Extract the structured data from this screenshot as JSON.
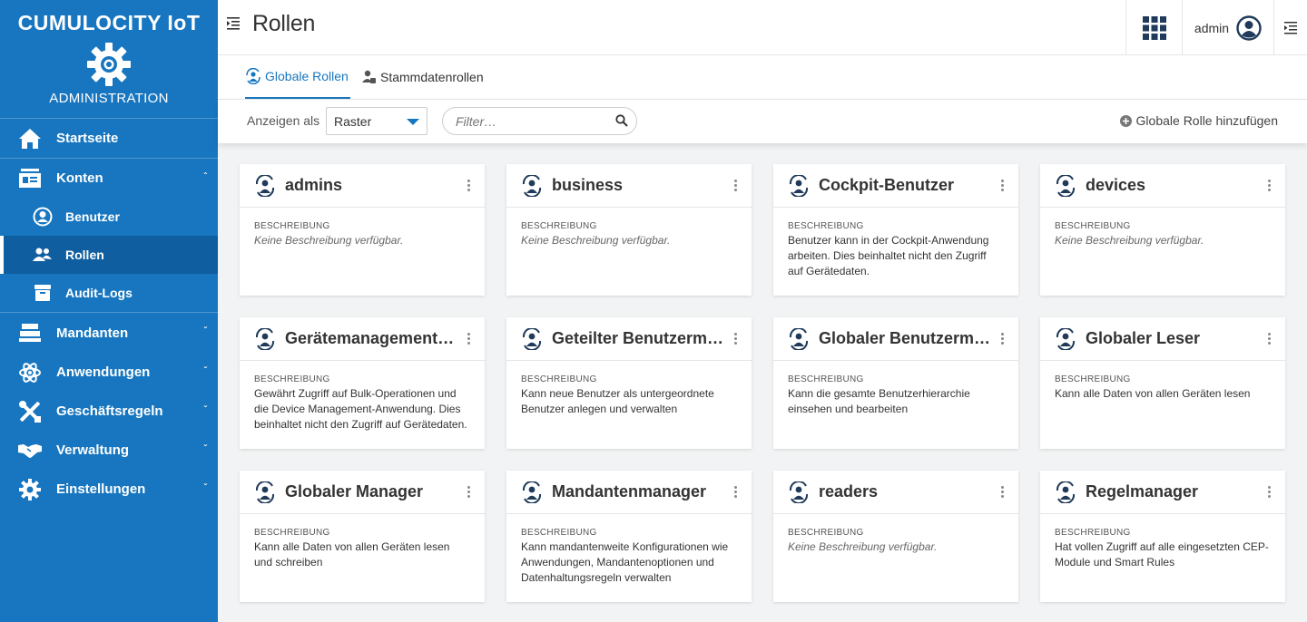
{
  "brand": "CUMULOCITY IoT",
  "app_name": "ADMINISTRATION",
  "nav": {
    "startseite": "Startseite",
    "konten": "Konten",
    "benutzer": "Benutzer",
    "rollen": "Rollen",
    "audit_logs": "Audit-Logs",
    "mandanten": "Mandanten",
    "anwendungen": "Anwendungen",
    "geschaeftsregeln": "Geschäftsregeln",
    "verwaltung": "Verwaltung",
    "einstellungen": "Einstellungen"
  },
  "header": {
    "title": "Rollen",
    "user": "admin"
  },
  "tabs": {
    "global": "Globale Rollen",
    "inventory": "Stammdatenrollen"
  },
  "toolbar": {
    "show_as_label": "Anzeigen als",
    "view_value": "Raster",
    "filter_placeholder": "Filter…",
    "add_label": "Globale Rolle hinzufügen"
  },
  "desc_label": "BESCHREIBUNG",
  "cards": [
    {
      "title": "admins",
      "desc": "Keine Beschreibung verfügbar."
    },
    {
      "title": "business",
      "desc": "Keine Beschreibung verfügbar."
    },
    {
      "title": "Cockpit-Benutzer",
      "desc": "Benutzer kann in der Cockpit-Anwendung arbeiten. Dies beinhaltet nicht den Zugriff auf Gerätedaten."
    },
    {
      "title": "devices",
      "desc": "Keine Beschreibung verfügbar."
    },
    {
      "title": "Gerätemanagement-Benutzer",
      "desc": "Gewährt Zugriff auf Bulk-Operationen und die Device Management-Anwendung. Dies beinhaltet nicht den Zugriff auf Gerätedaten."
    },
    {
      "title": "Geteilter Benutzermanager",
      "desc": "Kann neue Benutzer als untergeordnete Benutzer anlegen und verwalten"
    },
    {
      "title": "Globaler Benutzermanager",
      "desc": "Kann die gesamte Benutzerhierarchie einsehen und bearbeiten"
    },
    {
      "title": "Globaler Leser",
      "desc": "Kann alle Daten von allen Geräten lesen"
    },
    {
      "title": "Globaler Manager",
      "desc": "Kann alle Daten von allen Geräten lesen und schreiben"
    },
    {
      "title": "Mandantenmanager",
      "desc": "Kann mandantenweite Konfigurationen wie Anwendungen, Mandantenoptionen und Datenhaltungsregeln verwalten"
    },
    {
      "title": "readers",
      "desc": "Keine Beschreibung verfügbar."
    },
    {
      "title": "Regelmanager",
      "desc": "Hat vollen Zugriff auf alle eingesetzten CEP-Module und Smart Rules"
    }
  ],
  "colors": {
    "primary": "#1776bf",
    "primary_dark": "#0f5fa0",
    "icon_dark": "#1f3a5a"
  }
}
